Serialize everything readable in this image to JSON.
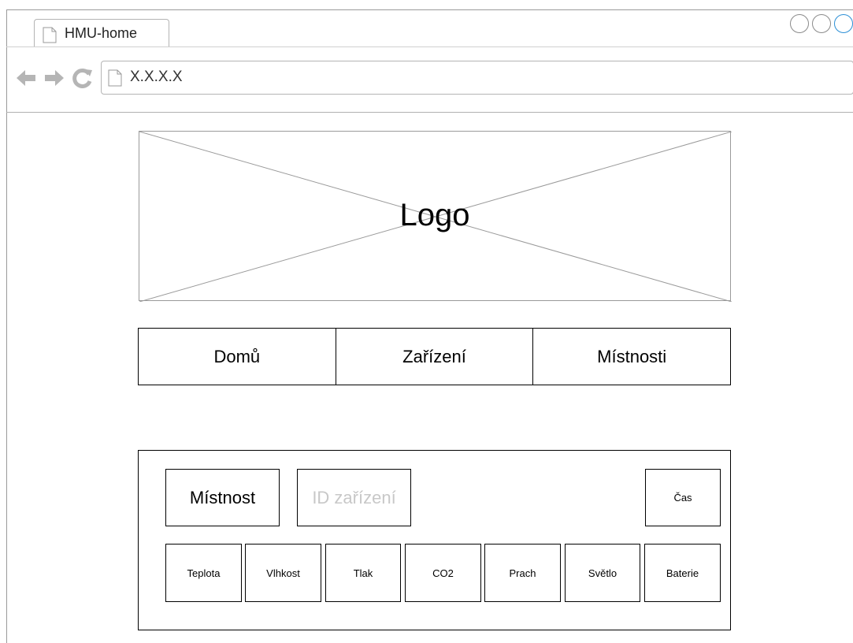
{
  "browser": {
    "tab_title": "HMU-home",
    "url": "X.X.X.X",
    "icons": [
      "page-icon",
      "back-arrow-icon",
      "forward-arrow-icon",
      "reload-icon"
    ]
  },
  "logo": {
    "label": "Logo"
  },
  "menu": {
    "items": [
      "Domů",
      "Zařízení",
      "Místnosti"
    ]
  },
  "panel": {
    "room": "Místnost",
    "device_id_placeholder": "ID zařízení",
    "time": "Čas",
    "metrics": [
      "Teplota",
      "Vlhkost",
      "Tlak",
      "CO2",
      "Prach",
      "Světlo",
      "Baterie"
    ]
  },
  "colors": {
    "window_control_accent": "#2b8fd6",
    "placeholder_text": "#c8c8c8"
  }
}
